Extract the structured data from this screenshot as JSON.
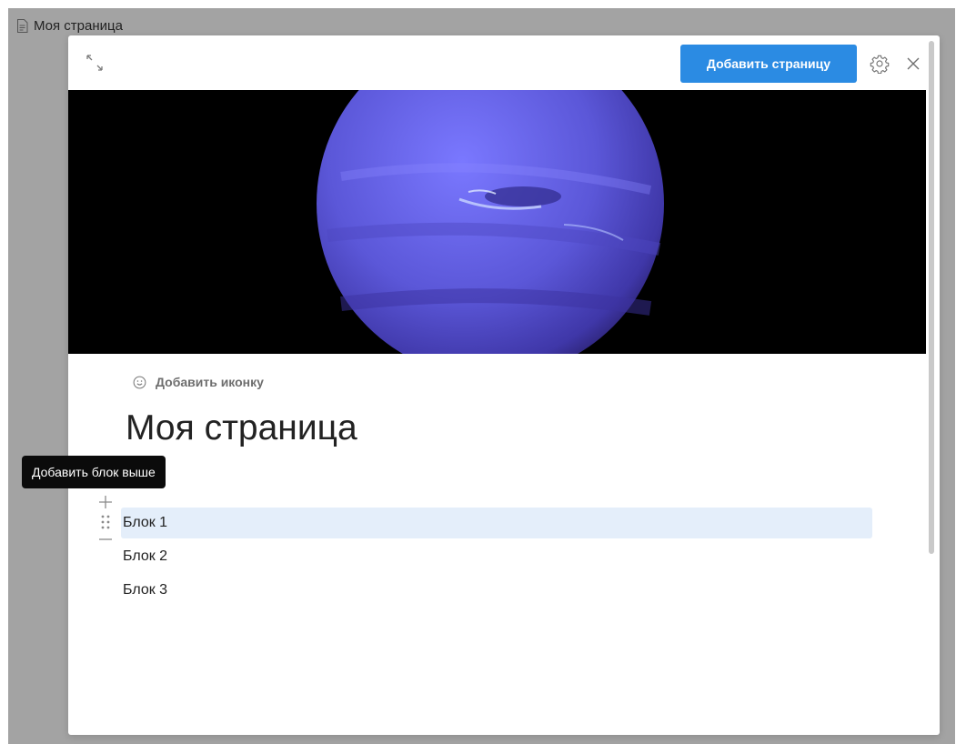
{
  "tab": {
    "label": "Моя страница",
    "icon": "document-icon"
  },
  "modal": {
    "expand_icon": "expand-icon",
    "add_page_label": "Добавить страницу",
    "settings_icon": "gear-icon",
    "close_icon": "close-icon"
  },
  "page": {
    "cover_image": "planet-cover-image",
    "add_icon_label": "Добавить иконку",
    "add_icon_glyph": "smile-icon",
    "title": "Моя страница",
    "blocks": [
      {
        "label": "Блок 1"
      },
      {
        "label": "Блок 2"
      },
      {
        "label": "Блок 3"
      }
    ]
  },
  "tooltip": {
    "text": "Добавить блок выше"
  },
  "colors": {
    "accent": "#2b8be3",
    "backdrop": "#a3a3a3",
    "active_block": "#e4eefa",
    "tooltip_bg": "#0b0b0b",
    "cover_planet": "#5b57d6"
  }
}
